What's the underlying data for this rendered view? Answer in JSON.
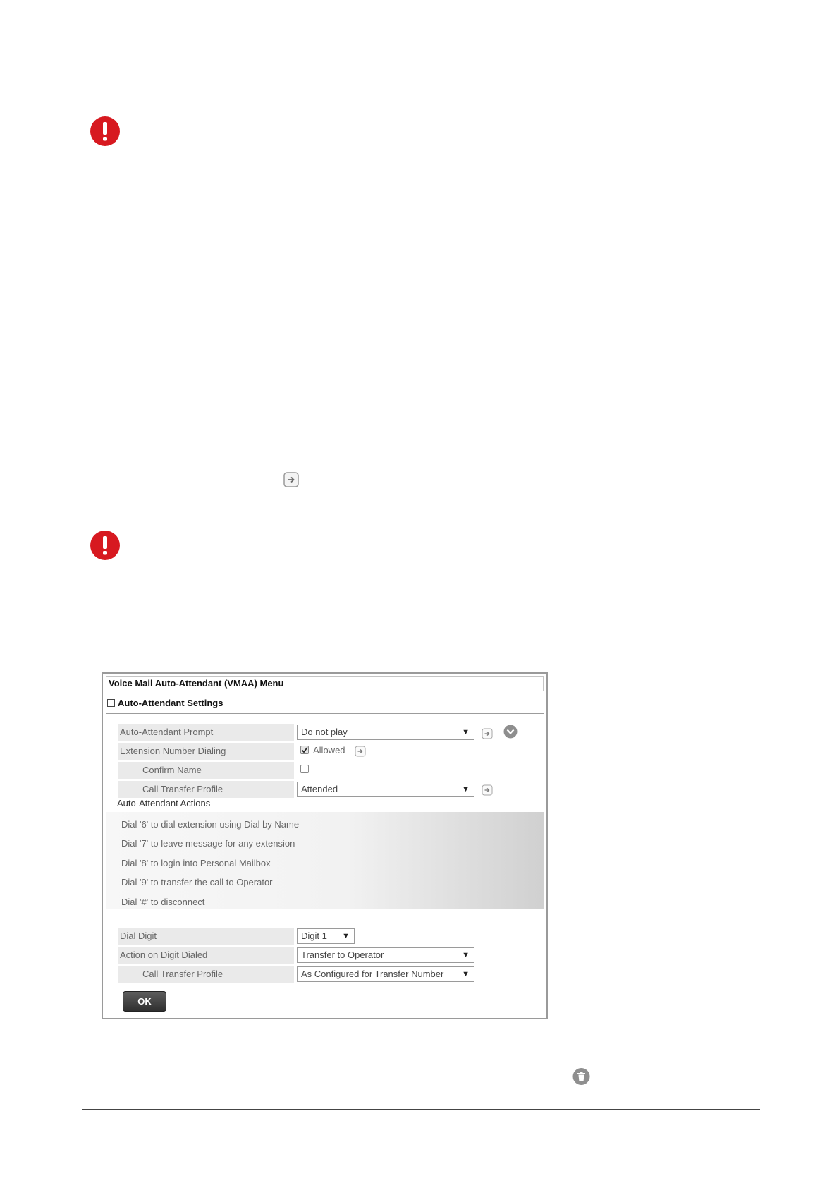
{
  "panel": {
    "title": "Voice Mail Auto-Attendant (VMAA) Menu",
    "section_title": "Auto-Attendant Settings"
  },
  "settings": {
    "prompt_label": "Auto-Attendant Prompt",
    "prompt_value": "Do not play",
    "ext_dialing_label": "Extension Number Dialing",
    "ext_dialing_checkbox_label": "Allowed",
    "ext_dialing_checked": true,
    "confirm_name_label": "Confirm Name",
    "confirm_name_checked": false,
    "transfer_profile_label": "Call Transfer Profile",
    "transfer_profile_value": "Attended"
  },
  "actions": {
    "heading": "Auto-Attendant Actions",
    "items": [
      "Dial '6' to dial extension using Dial by Name",
      "Dial '7' to leave message for any extension",
      "Dial '8' to login into Personal Mailbox",
      "Dial '9' to transfer the call to Operator",
      "Dial '#' to disconnect"
    ]
  },
  "digit_config": {
    "dial_digit_label": "Dial Digit",
    "dial_digit_value": "Digit 1",
    "action_label": "Action on Digit Dialed",
    "action_value": "Transfer to Operator",
    "transfer_profile_label": "Call Transfer Profile",
    "transfer_profile_value": "As Configured for Transfer Number"
  },
  "ok_label": "OK",
  "caret": "▼",
  "colors": {
    "warning": "#d71920",
    "ok_button": "#3a3a3a"
  },
  "icons": [
    "warning-icon",
    "arrow-right-icon",
    "chevron-down-icon",
    "trash-icon",
    "collapse-icon",
    "checkbox-icon"
  ]
}
